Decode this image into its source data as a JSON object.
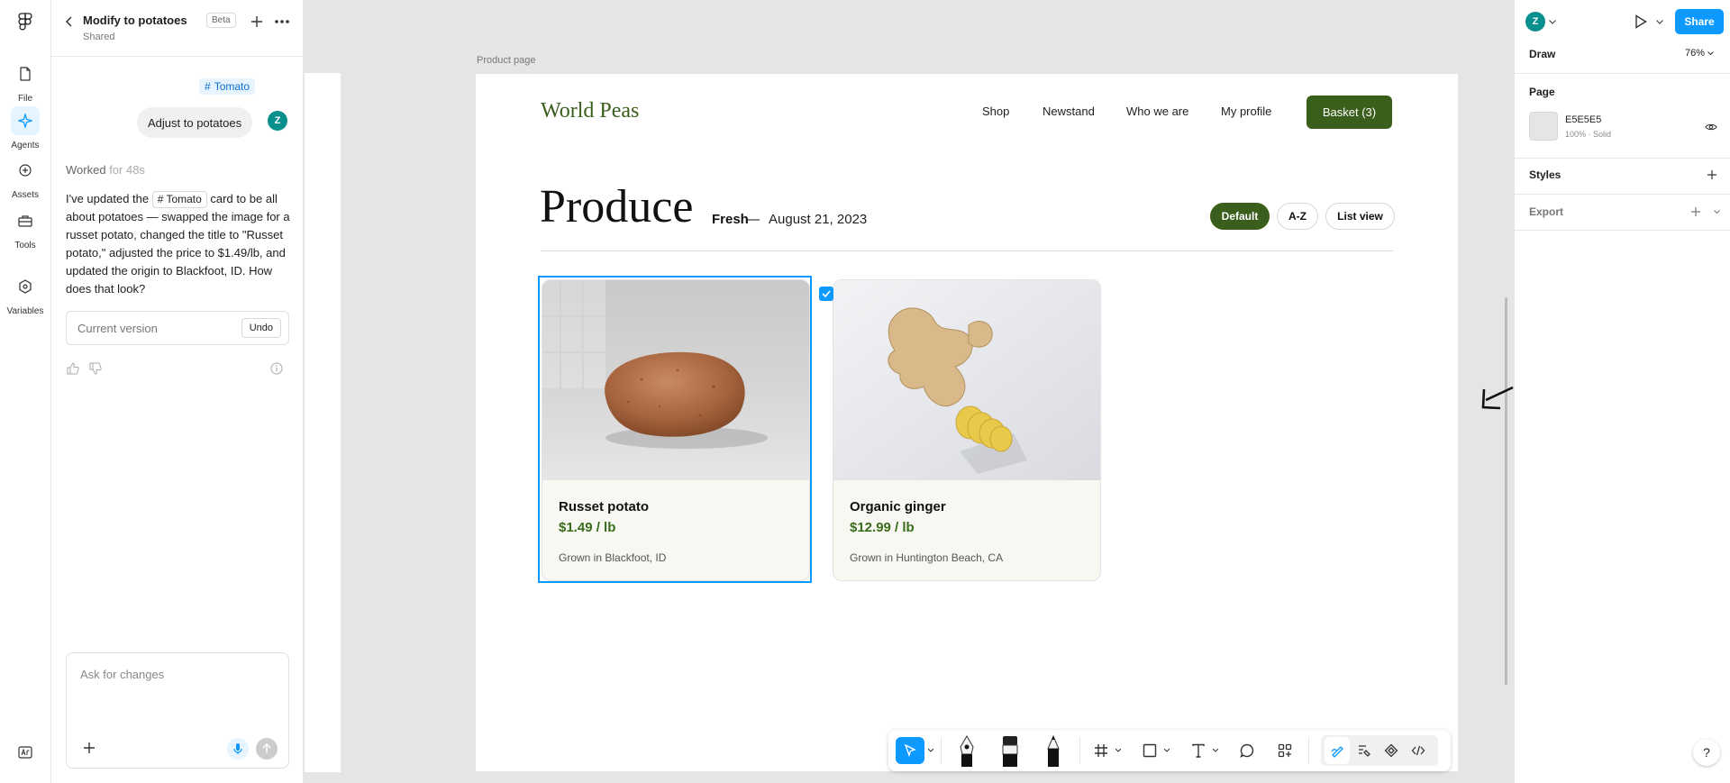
{
  "rail": {
    "items": [
      {
        "label": "File",
        "icon": "file-icon"
      },
      {
        "label": "Agents",
        "icon": "agents-icon"
      },
      {
        "label": "Assets",
        "icon": "assets-icon"
      },
      {
        "label": "Tools",
        "icon": "tools-icon"
      },
      {
        "label": "Variables",
        "icon": "variables-icon"
      }
    ],
    "active": "Agents"
  },
  "chat": {
    "title": "Modify to potatoes",
    "subtitle": "Shared",
    "badge": "Beta",
    "tag_chip": "Tomato",
    "user_message": "Adjust to potatoes",
    "user_initial": "Z",
    "worked_label": "Worked",
    "worked_duration": "for 48s",
    "reply_part1": "I've updated the",
    "reply_chip": "Tomato",
    "reply_part2": "card to be all about potatoes — swapped the image for a russet potato, changed the title to \"Russet potato,\" adjusted the price to $1.49/lb, and updated the origin to Blackfoot, ID. How does that look?",
    "version_label": "Current version",
    "undo_label": "Undo",
    "ask_placeholder": "Ask for changes"
  },
  "canvas": {
    "frame_label": "Product page",
    "brand": "World Peas",
    "nav": [
      "Shop",
      "Newstand",
      "Who we are",
      "My profile"
    ],
    "basket": "Basket (3)",
    "heading": "Produce",
    "fresh": "Fresh",
    "dash": "—",
    "date": "August 21, 2023",
    "sort_options": [
      "Default",
      "A-Z",
      "List view"
    ],
    "cards": [
      {
        "name": "Russet potato",
        "price": "$1.49 / lb",
        "origin": "Grown in Blackfoot, ID",
        "image": "potato-image"
      },
      {
        "name": "Organic ginger",
        "price": "$12.99 / lb",
        "origin": "Grown in Huntington Beach, CA",
        "image": "ginger-image"
      }
    ]
  },
  "right_panel": {
    "user_initial": "Z",
    "share": "Share",
    "mode": "Draw",
    "zoom": "76%",
    "page_section": "Page",
    "page_color_hex": "E5E5E5",
    "page_color_meta": "100% · Solid",
    "styles_section": "Styles",
    "export_section": "Export",
    "help": "?"
  },
  "colors": {
    "accent": "#0d99ff",
    "brand_green": "#3a5e1c",
    "price_green": "#3a6b1c",
    "canvas_bg": "#E5E5E5",
    "avatar": "#0a8f8f"
  }
}
